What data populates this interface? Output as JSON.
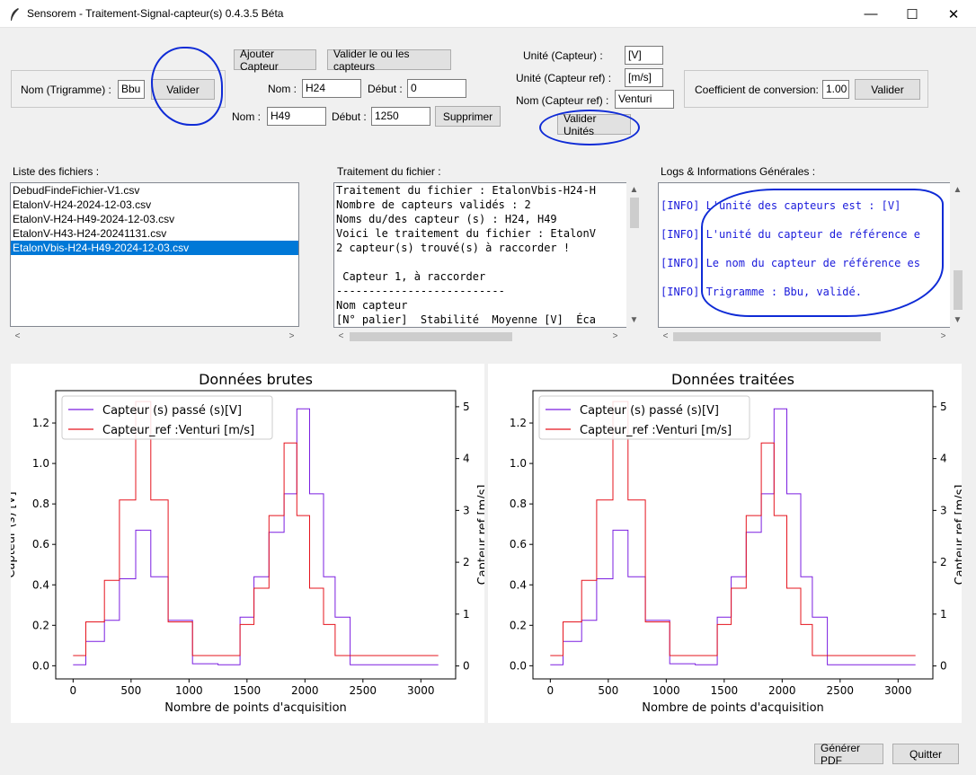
{
  "window": {
    "title": "Sensorem - Traitement-Signal-capteur(s) 0.4.3.5 Béta",
    "minimize": "—",
    "maximize": "☐",
    "close": "✕"
  },
  "trigram": {
    "label": "Nom (Trigramme) :",
    "value": "Bbu",
    "validate": "Valider"
  },
  "sensors": {
    "add": "Ajouter Capteur",
    "validate_all": "Valider le ou les capteurs",
    "remove": "Supprimer",
    "rows": [
      {
        "name_label": "Nom :",
        "name": "H24",
        "start_label": "Début :",
        "start": "0"
      },
      {
        "name_label": "Nom :",
        "name": "H49",
        "start_label": "Début :",
        "start": "1250"
      }
    ]
  },
  "units": {
    "sensor_label": "Unité (Capteur) :",
    "sensor_value": "[V]",
    "ref_label": "Unité (Capteur ref) :",
    "ref_value": "[m/s]",
    "ref_name_label": "Nom (Capteur ref) :",
    "ref_name_value": "Venturi",
    "validate": "Valider Unités"
  },
  "conversion": {
    "label": "Coefficient de conversion:",
    "value": "1.00",
    "validate": "Valider"
  },
  "files": {
    "label": "Liste des fichiers :",
    "items": [
      "DebudFindeFichier-V1.csv",
      "EtalonV-H24-2024-12-03.csv",
      "EtalonV-H24-H49-2024-12-03.csv",
      "EtalonV-H43-H24-20241131.csv",
      "EtalonVbis-H24-H49-2024-12-03.csv"
    ],
    "selected_index": 4
  },
  "processing": {
    "label": "Traitement du fichier :",
    "lines": [
      "Traitement du fichier : EtalonVbis-H24-H",
      "Nombre de capteurs validés : 2",
      "Noms du/des capteur (s) : H24, H49",
      "Voici le traitement du fichier : EtalonV",
      "2 capteur(s) trouvé(s) à raccorder !",
      "",
      " Capteur 1, à raccorder",
      "--------------------------",
      "Nom capteur",
      "[N° palier]  Stabilité  Moyenne [V]  Éca"
    ]
  },
  "logs": {
    "label": "Logs & Informations Générales :",
    "lines": [
      "[INFO] L'unité des capteurs est : [V]",
      "[INFO] L'unité du capteur de référence e",
      "[INFO] Le nom du capteur de référence es",
      "[INFO] Trigramme : Bbu, validé."
    ]
  },
  "footer": {
    "pdf": "Générer PDF",
    "quit": "Quitter"
  },
  "chart_data": [
    {
      "type": "line",
      "title": "Données brutes",
      "xlabel": "Nombre de points d'acquisition",
      "ylabel": "Capteur (s) [V]",
      "ylabel2": "Capteur ref [m/s]",
      "xlim": [
        -150,
        3300
      ],
      "ylim": [
        -0.065,
        1.36
      ],
      "ylim2": [
        -0.25,
        5.31
      ],
      "xticks": [
        0,
        500,
        1000,
        1500,
        2000,
        2500,
        3000
      ],
      "yticks": [
        0.0,
        0.2,
        0.4,
        0.6,
        0.8,
        1.0,
        1.2
      ],
      "yticks2": [
        0,
        1,
        2,
        3,
        4,
        5
      ],
      "legend": "upper left",
      "series": [
        {
          "name": "Capteur (s) passé (s)[V]",
          "color": "#7b1fe0",
          "axis": "left",
          "x": [
            0,
            110,
            110,
            270,
            270,
            400,
            400,
            540,
            540,
            670,
            670,
            820,
            820,
            1030,
            1030,
            1250,
            1250,
            1440,
            1440,
            1560,
            1560,
            1690,
            1690,
            1820,
            1820,
            1930,
            1930,
            2040,
            2040,
            2160,
            2160,
            2260,
            2260,
            2390,
            2390,
            2440,
            2440,
            3150
          ],
          "y": [
            0.005,
            0.005,
            0.12,
            0.12,
            0.225,
            0.225,
            0.43,
            0.43,
            0.67,
            0.67,
            0.44,
            0.44,
            0.225,
            0.225,
            0.01,
            0.01,
            0.005,
            0.005,
            0.24,
            0.24,
            0.44,
            0.44,
            0.66,
            0.66,
            0.85,
            0.85,
            1.27,
            1.27,
            0.85,
            0.85,
            0.44,
            0.44,
            0.24,
            0.24,
            0.005,
            0.005,
            0.005,
            0.005
          ]
        },
        {
          "name": "Capteur_ref :Venturi [m/s]",
          "color": "#e5141e",
          "axis": "right",
          "x": [
            0,
            110,
            110,
            270,
            270,
            400,
            400,
            540,
            540,
            670,
            670,
            820,
            820,
            1030,
            1030,
            1250,
            1250,
            1440,
            1440,
            1560,
            1560,
            1690,
            1690,
            1820,
            1820,
            1930,
            1930,
            2040,
            2040,
            2160,
            2160,
            2260,
            2260,
            2390,
            2390,
            2440,
            2440,
            3150
          ],
          "y": [
            0.2,
            0.2,
            0.85,
            0.85,
            1.65,
            1.65,
            3.2,
            3.2,
            5.1,
            5.1,
            3.2,
            3.2,
            0.85,
            0.85,
            0.2,
            0.2,
            0.2,
            0.2,
            0.8,
            0.8,
            1.5,
            1.5,
            2.9,
            2.9,
            4.3,
            4.3,
            2.9,
            2.9,
            1.5,
            1.5,
            0.8,
            0.8,
            0.2,
            0.2,
            0.2,
            0.2,
            0.2,
            0.2
          ]
        }
      ]
    },
    {
      "type": "line",
      "title": "Données traitées",
      "xlabel": "Nombre de points d'acquisition",
      "ylabel2": "Capteur ref [m/s]",
      "xlim": [
        -150,
        3300
      ],
      "ylim": [
        -0.065,
        1.36
      ],
      "ylim2": [
        -0.25,
        5.31
      ],
      "xticks": [
        0,
        500,
        1000,
        1500,
        2000,
        2500,
        3000
      ],
      "yticks": [
        0.0,
        0.2,
        0.4,
        0.6,
        0.8,
        1.0,
        1.2
      ],
      "yticks2": [
        0,
        1,
        2,
        3,
        4,
        5
      ],
      "legend": "upper left",
      "series": [
        {
          "name": "Capteur (s) passé (s)[V]",
          "color": "#7b1fe0",
          "axis": "left",
          "x": [
            0,
            110,
            110,
            270,
            270,
            400,
            400,
            540,
            540,
            670,
            670,
            820,
            820,
            1030,
            1030,
            1250,
            1250,
            1440,
            1440,
            1560,
            1560,
            1690,
            1690,
            1820,
            1820,
            1930,
            1930,
            2040,
            2040,
            2160,
            2160,
            2260,
            2260,
            2390,
            2390,
            2440,
            2440,
            3150
          ],
          "y": [
            0.005,
            0.005,
            0.12,
            0.12,
            0.225,
            0.225,
            0.43,
            0.43,
            0.67,
            0.67,
            0.44,
            0.44,
            0.225,
            0.225,
            0.01,
            0.01,
            0.005,
            0.005,
            0.24,
            0.24,
            0.44,
            0.44,
            0.66,
            0.66,
            0.85,
            0.85,
            1.27,
            1.27,
            0.85,
            0.85,
            0.44,
            0.44,
            0.24,
            0.24,
            0.005,
            0.005,
            0.005,
            0.005
          ]
        },
        {
          "name": "Capteur_ref :Venturi [m/s]",
          "color": "#e5141e",
          "axis": "right",
          "x": [
            0,
            110,
            110,
            270,
            270,
            400,
            400,
            540,
            540,
            670,
            670,
            820,
            820,
            1030,
            1030,
            1250,
            1250,
            1440,
            1440,
            1560,
            1560,
            1690,
            1690,
            1820,
            1820,
            1930,
            1930,
            2040,
            2040,
            2160,
            2160,
            2260,
            2260,
            2390,
            2390,
            2440,
            2440,
            3150
          ],
          "y": [
            0.2,
            0.2,
            0.85,
            0.85,
            1.65,
            1.65,
            3.2,
            3.2,
            5.1,
            5.1,
            3.2,
            3.2,
            0.85,
            0.85,
            0.2,
            0.2,
            0.2,
            0.2,
            0.8,
            0.8,
            1.5,
            1.5,
            2.9,
            2.9,
            4.3,
            4.3,
            2.9,
            2.9,
            1.5,
            1.5,
            0.8,
            0.8,
            0.2,
            0.2,
            0.2,
            0.2,
            0.2,
            0.2
          ]
        }
      ]
    }
  ]
}
